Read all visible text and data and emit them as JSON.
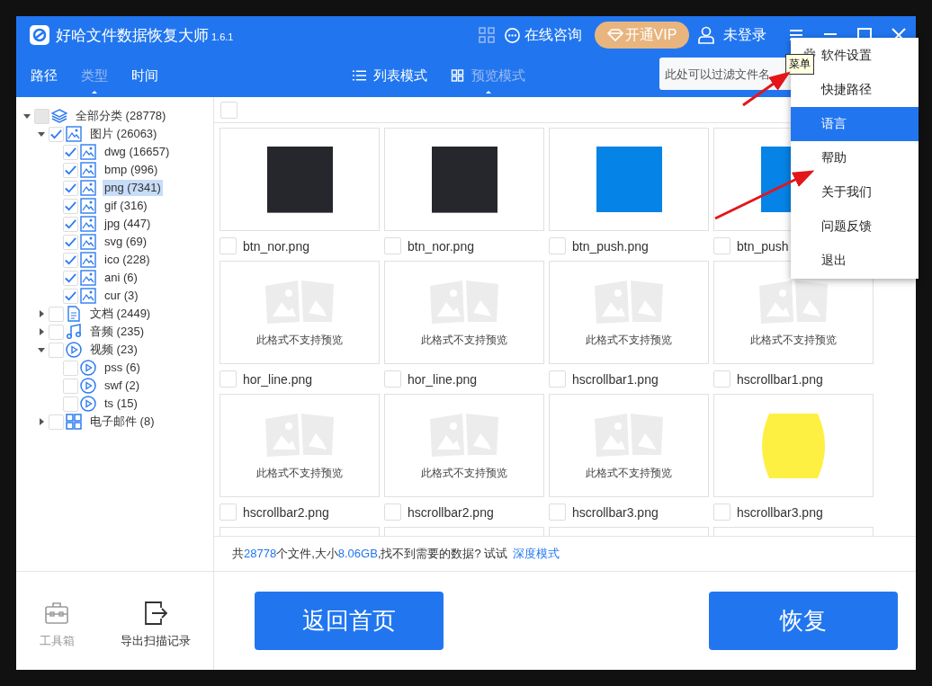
{
  "window": {
    "title": "好哈文件数据恢复大师",
    "version": "1.6.1",
    "consult": "在线咨询",
    "vip": "开通VIP",
    "login": "未登录"
  },
  "tabs": [
    {
      "label": "路径",
      "selected": false
    },
    {
      "label": "类型",
      "selected": true
    },
    {
      "label": "时间",
      "selected": false
    }
  ],
  "view_modes": [
    {
      "label": "列表模式",
      "kind": "list",
      "selected": false
    },
    {
      "label": "预览模式",
      "kind": "grid",
      "selected": true
    }
  ],
  "filter": {
    "placeholder": "此处可以过滤文件名"
  },
  "tooltip": "菜单",
  "menu": [
    {
      "label": "软件设置",
      "icon": true,
      "selected": false
    },
    {
      "label": "快捷路径",
      "icon": false,
      "selected": false
    },
    {
      "label": "语言",
      "icon": false,
      "selected": true
    },
    {
      "label": "帮助",
      "icon": false,
      "selected": false
    },
    {
      "label": "关于我们",
      "icon": false,
      "selected": false
    },
    {
      "label": "问题反馈",
      "icon": false,
      "selected": false
    },
    {
      "label": "退出",
      "icon": false,
      "selected": false
    }
  ],
  "tree": [
    {
      "label": "全部分类 (28778)",
      "kind": "layers",
      "checked": false,
      "partial": true,
      "selected": false,
      "expanded": true,
      "children": [
        {
          "label": "图片 (26063)",
          "kind": "image",
          "checked": true,
          "partial": false,
          "selected": false,
          "expanded": true,
          "children": [
            {
              "label": "dwg (16657)",
              "kind": "image",
              "checked": true,
              "partial": false,
              "selected": false
            },
            {
              "label": "bmp (996)",
              "kind": "image",
              "checked": true,
              "partial": false,
              "selected": false
            },
            {
              "label": "png (7341)",
              "kind": "image",
              "checked": true,
              "partial": false,
              "selected": true
            },
            {
              "label": "gif (316)",
              "kind": "image",
              "checked": true,
              "partial": false,
              "selected": false
            },
            {
              "label": "jpg (447)",
              "kind": "image",
              "checked": true,
              "partial": false,
              "selected": false
            },
            {
              "label": "svg (69)",
              "kind": "image",
              "checked": true,
              "partial": false,
              "selected": false
            },
            {
              "label": "ico (228)",
              "kind": "image",
              "checked": true,
              "partial": false,
              "selected": false
            },
            {
              "label": "ani (6)",
              "kind": "image",
              "checked": true,
              "partial": false,
              "selected": false
            },
            {
              "label": "cur (3)",
              "kind": "image",
              "checked": true,
              "partial": false,
              "selected": false
            }
          ]
        },
        {
          "label": "文档 (2449)",
          "kind": "document",
          "checked": false,
          "partial": false,
          "selected": false,
          "expanded": false
        },
        {
          "label": "音频 (235)",
          "kind": "audio",
          "checked": false,
          "partial": false,
          "selected": false,
          "expanded": false
        },
        {
          "label": "视频 (23)",
          "kind": "video",
          "checked": false,
          "partial": false,
          "selected": false,
          "expanded": true,
          "children": [
            {
              "label": "pss (6)",
              "kind": "video",
              "checked": false,
              "partial": false,
              "selected": false
            },
            {
              "label": "swf (2)",
              "kind": "video",
              "checked": false,
              "partial": false,
              "selected": false
            },
            {
              "label": "ts (15)",
              "kind": "video",
              "checked": false,
              "partial": false,
              "selected": false
            }
          ]
        },
        {
          "label": "电子邮件 (8)",
          "kind": "grid",
          "checked": false,
          "partial": false,
          "selected": false,
          "expanded": false
        }
      ]
    }
  ],
  "select_all": {
    "checked": false
  },
  "files": [
    {
      "name": "btn_nor.png",
      "kind": "dark",
      "checked": false
    },
    {
      "name": "btn_nor.png",
      "kind": "dark",
      "checked": false
    },
    {
      "name": "btn_push.png",
      "kind": "blue",
      "checked": false
    },
    {
      "name": "btn_push",
      "kind": "blue",
      "checked": false
    },
    {
      "name": "hor_line.png",
      "kind": "unsupported",
      "caption": "此格式不支持预览",
      "checked": false
    },
    {
      "name": "hor_line.png",
      "kind": "unsupported",
      "caption": "此格式不支持预览",
      "checked": false
    },
    {
      "name": "hscrollbar1.png",
      "kind": "unsupported",
      "caption": "此格式不支持预览",
      "checked": false
    },
    {
      "name": "hscrollbar1.png",
      "kind": "unsupported",
      "caption": "此格式不支持预览",
      "checked": false
    },
    {
      "name": "hscrollbar2.png",
      "kind": "unsupported",
      "caption": "此格式不支持预览",
      "checked": false
    },
    {
      "name": "hscrollbar2.png",
      "kind": "unsupported",
      "caption": "此格式不支持预览",
      "checked": false
    },
    {
      "name": "hscrollbar3.png",
      "kind": "unsupported",
      "caption": "此格式不支持预览",
      "checked": false
    },
    {
      "name": "hscrollbar3.png",
      "kind": "yellow",
      "checked": false
    }
  ],
  "status": {
    "parts": [
      {
        "text": "共",
        "highlight": false
      },
      {
        "text": "28778",
        "highlight": true
      },
      {
        "text": "个文件,大小",
        "highlight": false
      },
      {
        "text": "8.06GB",
        "highlight": true
      },
      {
        "text": ",找不到需要的数据? 试试",
        "highlight": false
      }
    ],
    "link": "深度模式"
  },
  "tools": [
    {
      "label": "工具箱",
      "kind": "toolbox",
      "disabled": true
    },
    {
      "label": "导出扫描记录",
      "kind": "export",
      "disabled": false
    }
  ],
  "buttons": [
    {
      "label": "返回首页"
    },
    {
      "label": "恢复"
    }
  ]
}
